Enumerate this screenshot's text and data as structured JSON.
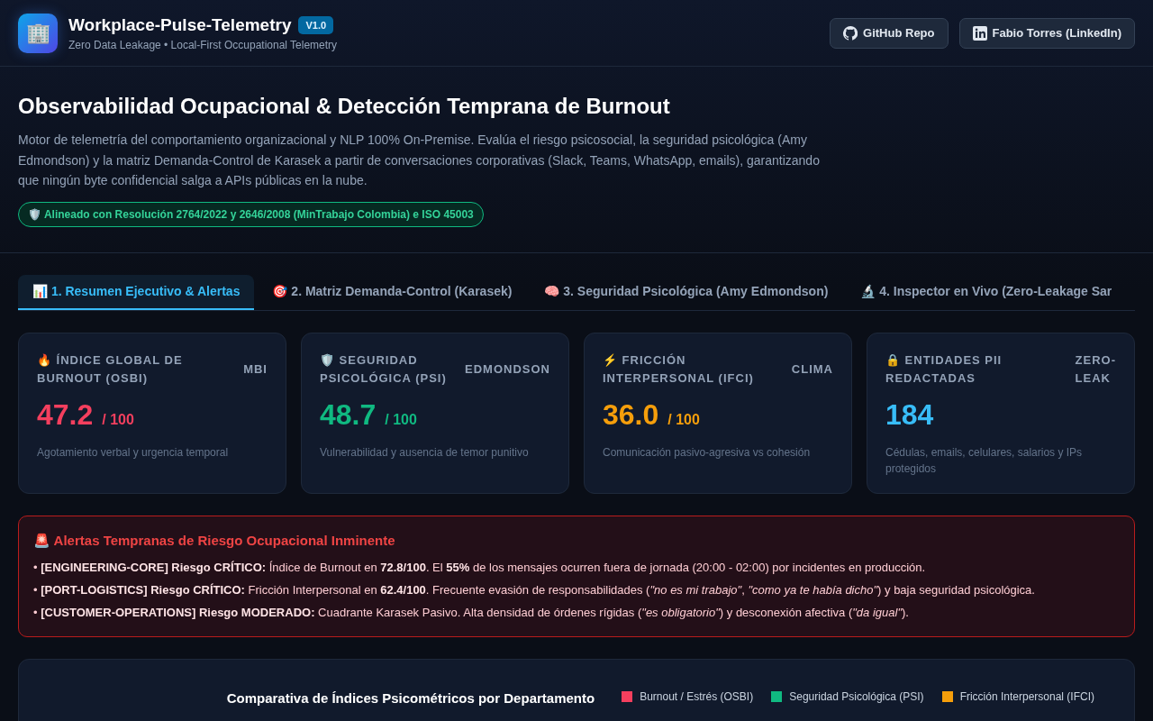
{
  "header": {
    "logo_icon": "🏢",
    "title": "Workplace-Pulse-Telemetry",
    "version": "V1.0",
    "subtitle": "Zero Data Leakage • Local-First Occupational Telemetry",
    "links": [
      {
        "kind": "github",
        "label": "GitHub Repo"
      },
      {
        "kind": "linkedin",
        "label": "Fabio Torres (LinkedIn)"
      }
    ]
  },
  "hero": {
    "title": "Observabilidad Ocupacional & Detección Temprana de Burnout",
    "description": "Motor de telemetría del comportamiento organizacional y NLP 100% On-Premise. Evalúa el riesgo psicosocial, la seguridad psicológica (Amy Edmondson) y la matriz Demanda-Control de Karasek a partir de conversaciones corporativas (Slack, Teams, WhatsApp, emails), garantizando que ningún byte confidencial salga a APIs públicas en la nube.",
    "compliance_badge": "🛡️ Alineado con Resolución 2764/2022 y 2646/2008 (MinTrabajo Colombia) e ISO 45003"
  },
  "tabs": [
    {
      "label": "📊 1. Resumen Ejecutivo & Alertas",
      "selected": true
    },
    {
      "label": "🎯 2. Matriz Demanda-Control (Karasek)",
      "selected": false
    },
    {
      "label": "🧠 3. Seguridad Psicológica (Amy Edmondson)",
      "selected": false
    },
    {
      "label": "🔬 4. Inspector en Vivo (Zero-Leakage Sar",
      "selected": false
    }
  ],
  "metrics": [
    {
      "label": "🔥 ÍNDICE GLOBAL DE BURNOUT (OSBI)",
      "tag": "MBI",
      "value": "47.2",
      "suffix": "/ 100",
      "color": "#f43f5e",
      "description": "Agotamiento verbal y urgencia temporal"
    },
    {
      "label": "🛡️ SEGURIDAD PSICOLÓGICA (PSI)",
      "tag": "EDMONDSON",
      "value": "48.7",
      "suffix": "/ 100",
      "color": "#10b981",
      "description": "Vulnerabilidad y ausencia de temor punitivo"
    },
    {
      "label": "⚡ FRICCIÓN INTERPERSONAL (IFCI)",
      "tag": "CLIMA",
      "value": "36.0",
      "suffix": "/ 100",
      "color": "#f59e0b",
      "description": "Comunicación pasivo-agresiva vs cohesión"
    },
    {
      "label": "🔒 ENTIDADES PII REDACTADAS",
      "tag": "ZERO-LEAK",
      "value": "184",
      "color": "#38bdf8",
      "description": "Cédulas, emails, celulares, salarios y IPs protegidos"
    }
  ],
  "alerts": {
    "title": "🚨 Alertas Tempranas de Riesgo Ocupacional Inminente",
    "items": [
      "• **[ENGINEERING-CORE] Riesgo CRÍTICO:** Índice de Burnout en **72.8/100**. El **55%** de los mensajes ocurren fuera de jornada (20:00 - 02:00) por incidentes en producción.",
      "• **[PORT-LOGISTICS] Riesgo CRÍTICO:** Fricción Interpersonal en **62.4/100**. Frecuente evasión de responsabilidades (*\"no es mi trabajo\"*, *\"como ya te había dicho\"*) y baja seguridad psicológica.",
      "• **[CUSTOMER-OPERATIONS] Riesgo MODERADO:** Cuadrante Karasek Pasivo. Alta densidad de órdenes rígidas (*\"es obligatorio\"*) y desconexión afectiva (*\"da igual\"*)."
    ]
  },
  "chart": {
    "title": "Comparativa de Índices Psicométricos por Departamento",
    "legend": [
      {
        "label": "Burnout / Estrés (OSBI)",
        "color": "#f43f5e"
      },
      {
        "label": "Seguridad Psicológica (PSI)",
        "color": "#10b981"
      },
      {
        "label": "Fricción Interpersonal (IFCI)",
        "color": "#f59e0b"
      }
    ]
  }
}
